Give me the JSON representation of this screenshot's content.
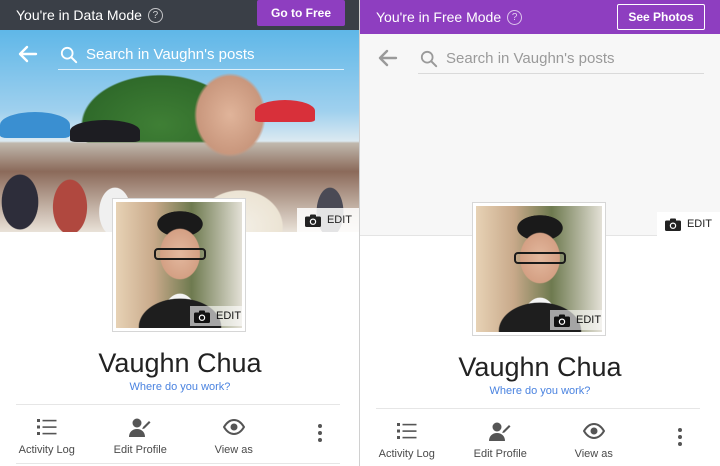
{
  "panels": {
    "data_mode": {
      "mode_text": "You're in Data Mode",
      "mode_button": "Go to Free",
      "search_placeholder": "Search in Vaughn's posts",
      "cover_edit": "EDIT",
      "photo_edit": "EDIT",
      "name": "Vaughn Chua",
      "workplace_prompt": "Where do you work?",
      "actions": [
        {
          "label": "Activity Log",
          "icon": "list-icon"
        },
        {
          "label": "Edit Profile",
          "icon": "edit-profile-icon"
        },
        {
          "label": "View as",
          "icon": "eye-icon"
        },
        {
          "label": "",
          "icon": "more-vertical-icon"
        }
      ]
    },
    "free_mode": {
      "mode_text": "You're in Free Mode",
      "mode_button": "See Photos",
      "search_placeholder": "Search in Vaughn's posts",
      "cover_edit": "EDIT",
      "photo_edit": "EDIT",
      "name": "Vaughn Chua",
      "workplace_prompt": "Where do you work?",
      "actions": [
        {
          "label": "Activity Log",
          "icon": "list-icon"
        },
        {
          "label": "Edit Profile",
          "icon": "edit-profile-icon"
        },
        {
          "label": "View as",
          "icon": "eye-icon"
        },
        {
          "label": "",
          "icon": "more-vertical-icon"
        }
      ]
    }
  },
  "colors": {
    "data_mode_bar": "#3a3f47",
    "free_mode_accent": "#8e3ec0",
    "link": "#4a83e0"
  }
}
